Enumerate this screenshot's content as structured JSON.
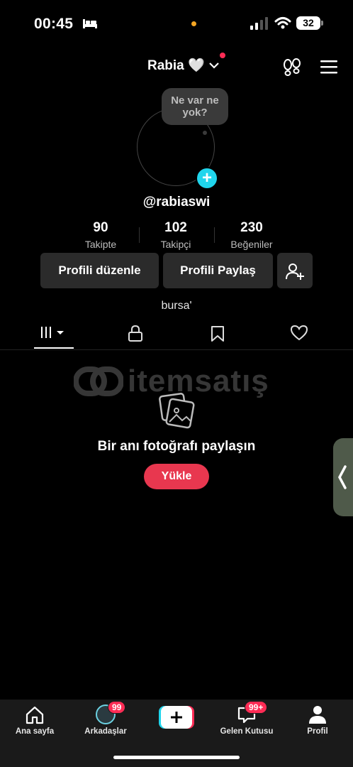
{
  "status_bar": {
    "time": "00:45",
    "battery": "32"
  },
  "header": {
    "username": "Rabia 🤍"
  },
  "profile": {
    "note_text": "Ne var ne yok?",
    "handle": "@rabiaswi",
    "stats": [
      {
        "value": "90",
        "label": "Takipte"
      },
      {
        "value": "102",
        "label": "Takipçi"
      },
      {
        "value": "230",
        "label": "Beğeniler"
      }
    ],
    "edit_button": "Profili düzenle",
    "share_button": "Profili Paylaş",
    "bio": "bursa'"
  },
  "watermark": {
    "text": "itemsatış"
  },
  "empty_state": {
    "title": "Bir anı fotoğrafı paylaşın",
    "upload_label": "Yükle"
  },
  "bottom_nav": {
    "items": [
      {
        "label": "Ana sayfa"
      },
      {
        "label": "Arkadaşlar",
        "badge": "99"
      },
      {
        "label": "Gelen Kutusu",
        "badge": "99+"
      },
      {
        "label": "Profil"
      }
    ]
  },
  "colors": {
    "accent": "#fe2c55",
    "upload": "#e8374f",
    "cyan": "#20d5ec",
    "button_bg": "#2b2b2b"
  }
}
